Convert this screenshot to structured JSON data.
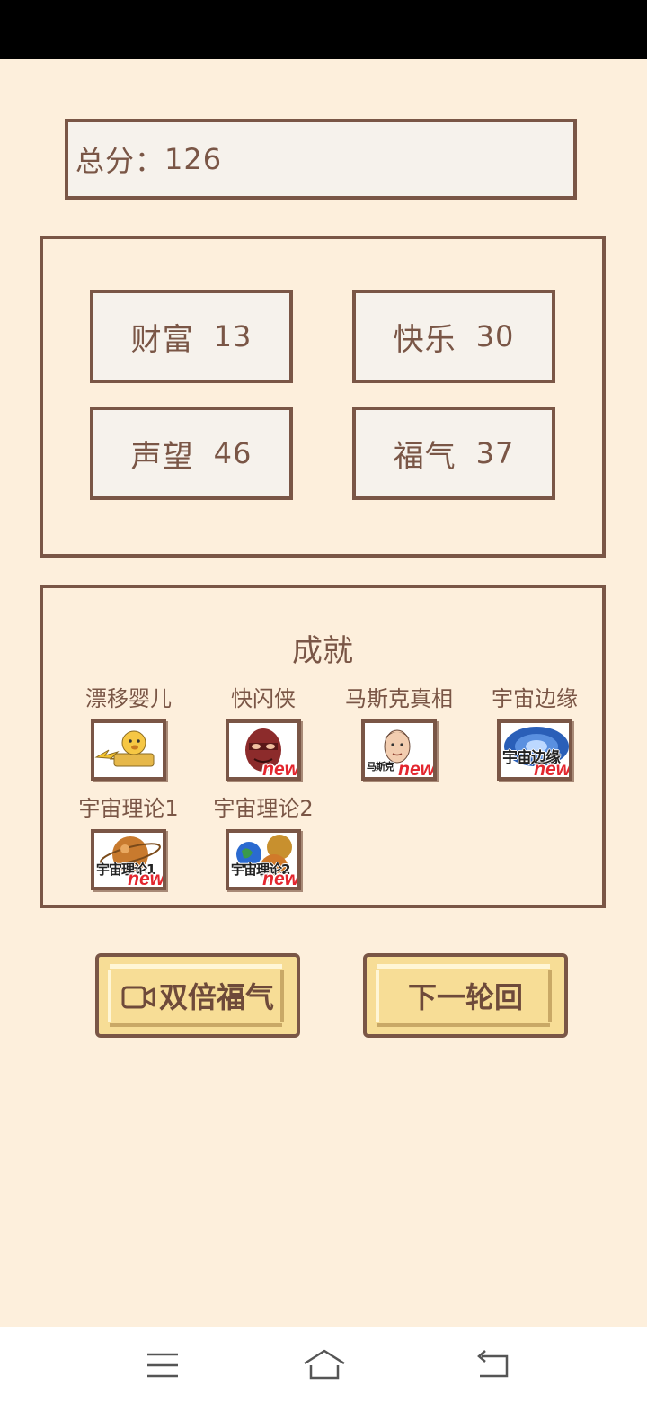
{
  "score": {
    "label": "总分：",
    "value": "126"
  },
  "stats": [
    {
      "name": "财富",
      "value": "13"
    },
    {
      "name": "快乐",
      "value": "30"
    },
    {
      "name": "声望",
      "value": "46"
    },
    {
      "name": "福气",
      "value": "37"
    }
  ],
  "achievements": {
    "title": "成就",
    "new_badge": "new",
    "items": [
      {
        "label": "漂移婴儿",
        "icon": "drift-baby-icon",
        "is_new": false,
        "thumb_text": ""
      },
      {
        "label": "快闪侠",
        "icon": "flash-hero-icon",
        "is_new": true,
        "thumb_text": ""
      },
      {
        "label": "马斯克真相",
        "icon": "musk-face-icon",
        "is_new": true,
        "thumb_text": "马斯克"
      },
      {
        "label": "宇宙边缘",
        "icon": "universe-edge-icon",
        "is_new": true,
        "thumb_text": "宇宙边缘"
      },
      {
        "label": "宇宙理论1",
        "icon": "planet-theory-1-icon",
        "is_new": true,
        "thumb_text": "宇宙理论1"
      },
      {
        "label": "宇宙理论2",
        "icon": "planet-theory-2-icon",
        "is_new": true,
        "thumb_text": "宇宙理论2"
      }
    ]
  },
  "buttons": {
    "double_luck": "双倍福气",
    "next_round": "下一轮回"
  },
  "colors": {
    "background": "#fdefdc",
    "border": "#7a5646",
    "button_fill": "#f7dd96",
    "new_badge": "#e3262e"
  },
  "nav": {
    "menu_icon": "menu-icon",
    "home_icon": "home-icon",
    "back_icon": "back-icon"
  }
}
